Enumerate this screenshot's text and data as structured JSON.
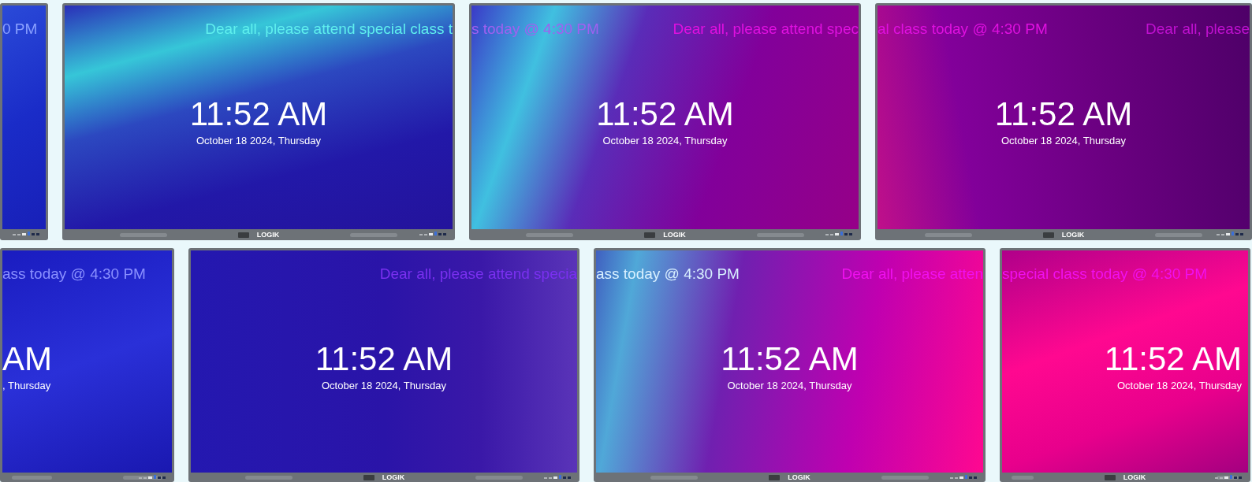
{
  "rows": [
    {
      "displays": [
        {
          "ticker_end": "0 PM"
        },
        {
          "ticker_start": "Dear all, please attend special class t",
          "time": "11:52 AM",
          "date": "October 18 2024, Thursday",
          "brand": "LOGIK"
        },
        {
          "ticker_end": "s today @ 4:30 PM",
          "ticker_start": "Dear all, please attend spec",
          "time": "11:52 AM",
          "date": "October 18 2024, Thursday",
          "brand": "LOGIK"
        },
        {
          "ticker_end": "al class today @ 4:30 PM",
          "ticker_start": "Dear all, please",
          "time": "11:52 AM",
          "date": "October 18 2024, Thursday",
          "brand": "LOGIK"
        }
      ]
    },
    {
      "displays": [
        {
          "ticker_end": "ass today @ 4:30 PM",
          "time": "AM",
          "date": ", Thursday"
        },
        {
          "ticker_start": "Dear all, please attend specia",
          "time": "11:52 AM",
          "date": "October 18 2024, Thursday",
          "brand": "LOGIK"
        },
        {
          "ticker_end": "ass today @ 4:30 PM",
          "ticker_start": "Dear all, please atten",
          "time": "11:52 AM",
          "date": "October 18 2024, Thursday",
          "brand": "LOGIK"
        },
        {
          "ticker_end": "special class today @ 4:30 PM",
          "time": "11:52 AM",
          "date": "October 18 2024, Thursday",
          "brand": "LOGIK"
        }
      ]
    }
  ]
}
